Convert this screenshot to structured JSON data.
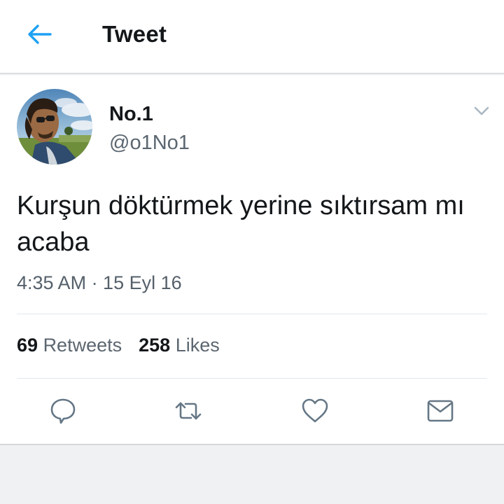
{
  "header": {
    "title": "Tweet",
    "back_icon": "arrow-left-icon",
    "accent_color": "#1da1f2"
  },
  "tweet": {
    "author": {
      "name": "No.1",
      "handle": "@o1No1",
      "avatar": "avatar-photo"
    },
    "text": "Kurşun döktürmek yerine sıktırsam mı acaba",
    "timestamp": "4:35 AM · 15 Eyl 16",
    "stats": {
      "retweets_count": "69",
      "retweets_label": "Retweets",
      "likes_count": "258",
      "likes_label": "Likes"
    },
    "actions": [
      "reply-icon",
      "retweet-icon",
      "like-icon",
      "direct-message-icon"
    ]
  }
}
